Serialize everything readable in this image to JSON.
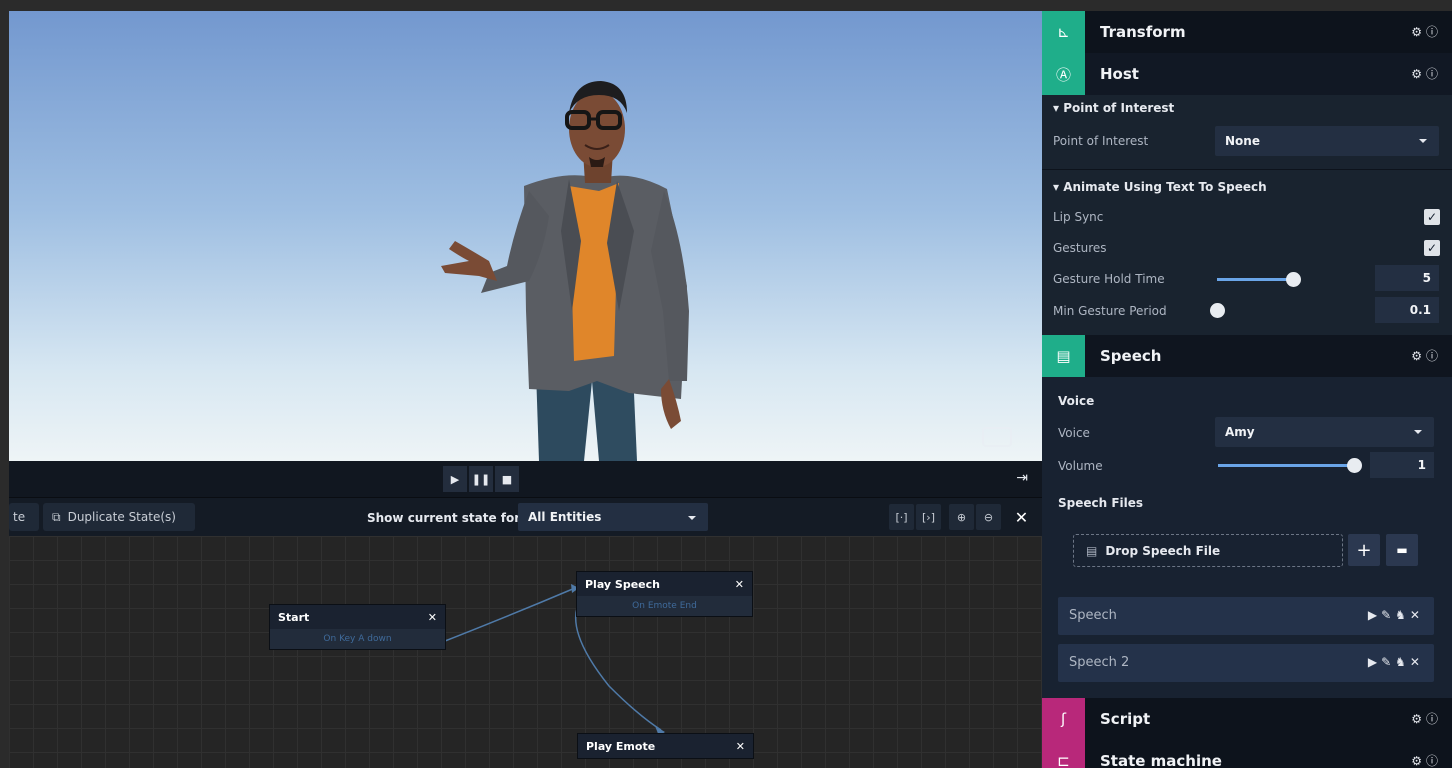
{
  "viewport": {
    "vr_icon": "vr-headset-icon"
  },
  "transport": {
    "play": "play-icon",
    "pause": "pause-icon",
    "stop": "stop-icon",
    "exit": "exit-icon"
  },
  "toolbar": {
    "partial_button": "te",
    "duplicate_label": "Duplicate State(s)",
    "show_label": "Show current state for:",
    "entity_select": "All Entities",
    "icons": [
      "fit-selection-icon",
      "fit-all-icon",
      "zoom-in-icon",
      "zoom-out-icon",
      "close-icon"
    ]
  },
  "graph": {
    "nodes": [
      {
        "title": "Start",
        "sub": "On Key A down"
      },
      {
        "title": "Play Speech",
        "sub": "On Emote End"
      },
      {
        "title": "Play Emote",
        "sub": ""
      }
    ]
  },
  "panel": {
    "transform": {
      "title": "Transform"
    },
    "host": {
      "title": "Host"
    },
    "poi_section": "Point of Interest",
    "poi_label": "Point of Interest",
    "poi_value": "None",
    "tts_section": "Animate Using Text To Speech",
    "lip_sync_label": "Lip Sync",
    "lip_sync": true,
    "gestures_label": "Gestures",
    "gestures": true,
    "hold_label": "Gesture Hold Time",
    "hold_value": "5",
    "hold_fraction": 0.95,
    "period_label": "Min Gesture Period",
    "period_value": "0.1",
    "period_fraction": 0.0,
    "speech": {
      "title": "Speech"
    },
    "voice_section": "Voice",
    "voice_label": "Voice",
    "voice_value": "Amy",
    "volume_label": "Volume",
    "volume_value": "1",
    "volume_fraction": 1.0,
    "files_section": "Speech Files",
    "drop_label": "Drop Speech File",
    "files": [
      {
        "name": "Speech"
      },
      {
        "name": "Speech 2"
      }
    ],
    "script": {
      "title": "Script"
    },
    "state_machine": {
      "title": "State machine"
    }
  },
  "colors": {
    "teal": "#1fae8a",
    "magenta": "#b8287a",
    "accent_blue": "#6aa5e8"
  }
}
